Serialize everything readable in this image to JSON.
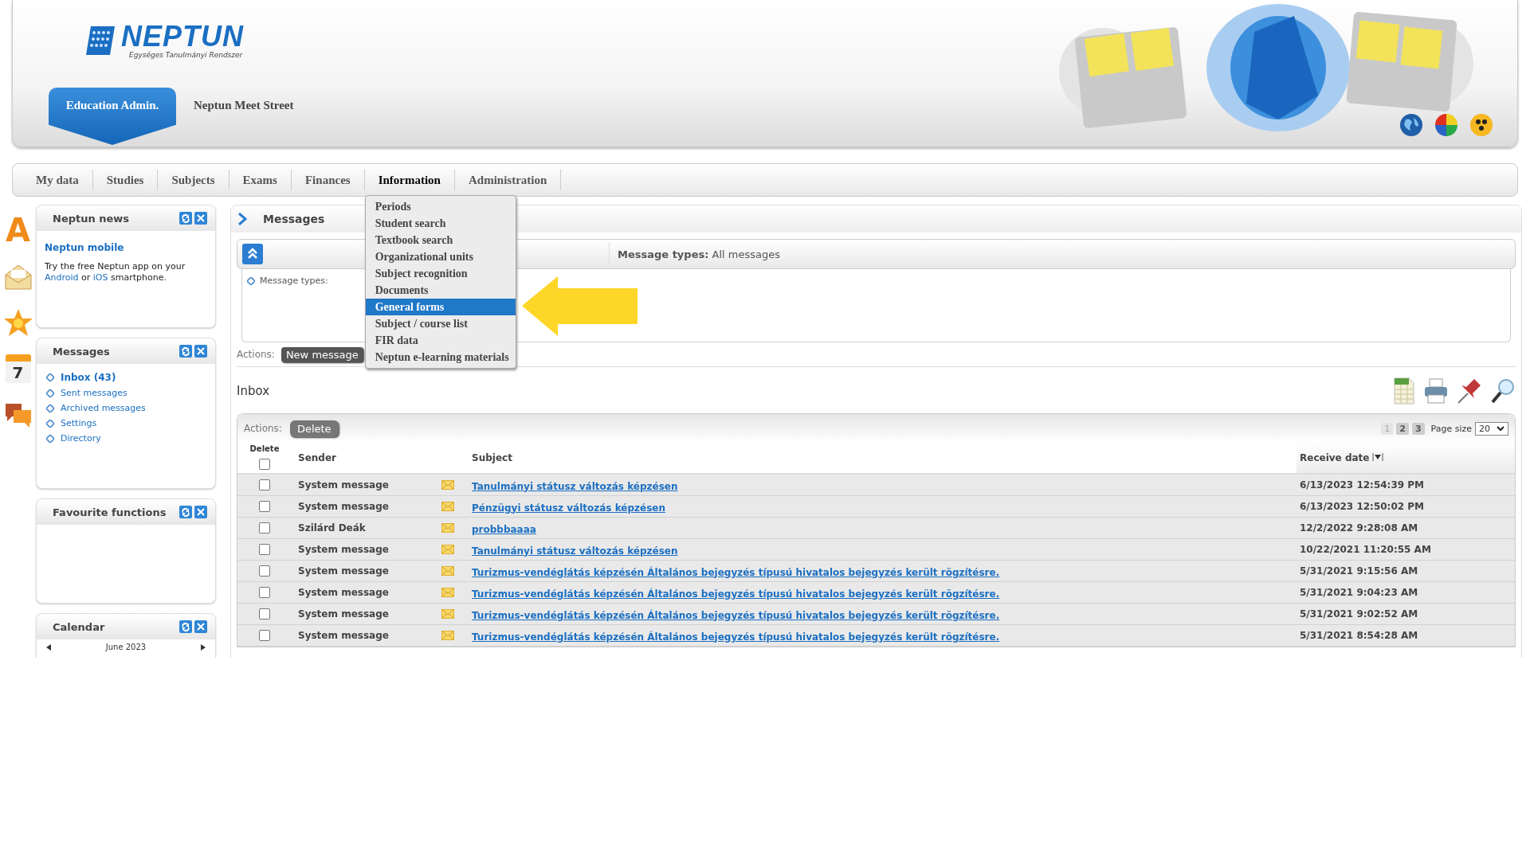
{
  "header": {
    "logo_title": "NEPTUN",
    "logo_subtitle": "Egységes Tanulmányi Rendszer",
    "role_tab": "Education Admin.",
    "user_name": "Neptun Meet Street"
  },
  "main_menu": [
    {
      "label": "My data",
      "selected": false
    },
    {
      "label": "Studies",
      "selected": false
    },
    {
      "label": "Subjects",
      "selected": false
    },
    {
      "label": "Exams",
      "selected": false
    },
    {
      "label": "Finances",
      "selected": false
    },
    {
      "label": "Information",
      "selected": true
    },
    {
      "label": "Administration",
      "selected": false
    }
  ],
  "dropdown": [
    {
      "label": "Periods",
      "selected": false
    },
    {
      "label": "Student search",
      "selected": false
    },
    {
      "label": "Textbook search",
      "selected": false
    },
    {
      "label": "Organizational units",
      "selected": false
    },
    {
      "label": "Subject recognition",
      "selected": false
    },
    {
      "label": "Documents",
      "selected": false
    },
    {
      "label": "General forms",
      "selected": true
    },
    {
      "label": "Subject / course list",
      "selected": false
    },
    {
      "label": "FIR data",
      "selected": false
    },
    {
      "label": "Neptun e-learning materials",
      "selected": false
    }
  ],
  "side_icons": [
    {
      "kind": "letter",
      "glyph": "A"
    },
    {
      "kind": "envelope"
    },
    {
      "kind": "star"
    },
    {
      "kind": "calendar",
      "glyph": "7"
    },
    {
      "kind": "chat"
    }
  ],
  "news_panel": {
    "title": "Neptun news",
    "headline": "Neptun mobile",
    "body": [
      {
        "kind": "text",
        "text": "Try the free Neptun app on your "
      },
      {
        "kind": "link",
        "text": "Android"
      },
      {
        "kind": "text",
        "text": " or "
      },
      {
        "kind": "link",
        "text": "iOS"
      },
      {
        "kind": "text",
        "text": " smartphone."
      }
    ]
  },
  "messages_panel": {
    "title": "Messages",
    "items": [
      {
        "label": "Inbox (43)",
        "selected": true
      },
      {
        "label": "Sent messages",
        "selected": false
      },
      {
        "label": "Archived messages",
        "selected": false
      },
      {
        "label": "Settings",
        "selected": false
      },
      {
        "label": "Directory",
        "selected": false
      }
    ]
  },
  "favourites_panel": {
    "title": "Favourite functions"
  },
  "calendar_panel": {
    "title": "Calendar",
    "month": "June 2023"
  },
  "main": {
    "title": "Messages",
    "filter_summary_label": "Message types:",
    "filter_summary_value": "All messages",
    "filter_label": "Message types:",
    "actions_label": "Actions:",
    "new_message": "New message"
  },
  "inbox": {
    "title": "Inbox",
    "actions_label": "Actions:",
    "delete_button": "Delete",
    "pages": [
      {
        "label": "1",
        "selected": true
      },
      {
        "label": "2",
        "selected": false
      },
      {
        "label": "3",
        "selected": false
      }
    ],
    "page_size_label": "Page size",
    "page_size": "20",
    "columns": {
      "delete": "Delete",
      "sender": "Sender",
      "subject": "Subject",
      "date": "Receive date"
    },
    "select_all_checked": false,
    "rows": [
      {
        "checked": false,
        "sender": "System message",
        "subject": "Tanulmányi státusz változás képzésen",
        "date": "6/13/2023 12:54:39 PM"
      },
      {
        "checked": false,
        "sender": "System message",
        "subject": "Pénzügyi státusz változás képzésen",
        "date": "6/13/2023 12:50:02 PM"
      },
      {
        "checked": false,
        "sender": "Szilárd Deák",
        "subject": "probbbaaaa",
        "date": "12/2/2022 9:28:08 AM"
      },
      {
        "checked": false,
        "sender": "System message",
        "subject": "Tanulmányi státusz változás képzésen",
        "date": "10/22/2021 11:20:55 AM"
      },
      {
        "checked": false,
        "sender": "System message",
        "subject": "Turizmus-vendéglátás képzésén Általános bejegyzés típusú hivatalos bejegyzés került rögzítésre.",
        "date": "5/31/2021 9:15:56 AM"
      },
      {
        "checked": false,
        "sender": "System message",
        "subject": "Turizmus-vendéglátás képzésén Általános bejegyzés típusú hivatalos bejegyzés került rögzítésre.",
        "date": "5/31/2021 9:04:23 AM"
      },
      {
        "checked": false,
        "sender": "System message",
        "subject": "Turizmus-vendéglátás képzésén Általános bejegyzés típusú hivatalos bejegyzés került rögzítésre.",
        "date": "5/31/2021 9:02:52 AM"
      },
      {
        "checked": false,
        "sender": "System message",
        "subject": "Turizmus-vendéglátás képzésén Általános bejegyzés típusú hivatalos bejegyzés került rögzítésre.",
        "date": "5/31/2021 8:54:28 AM"
      }
    ]
  }
}
